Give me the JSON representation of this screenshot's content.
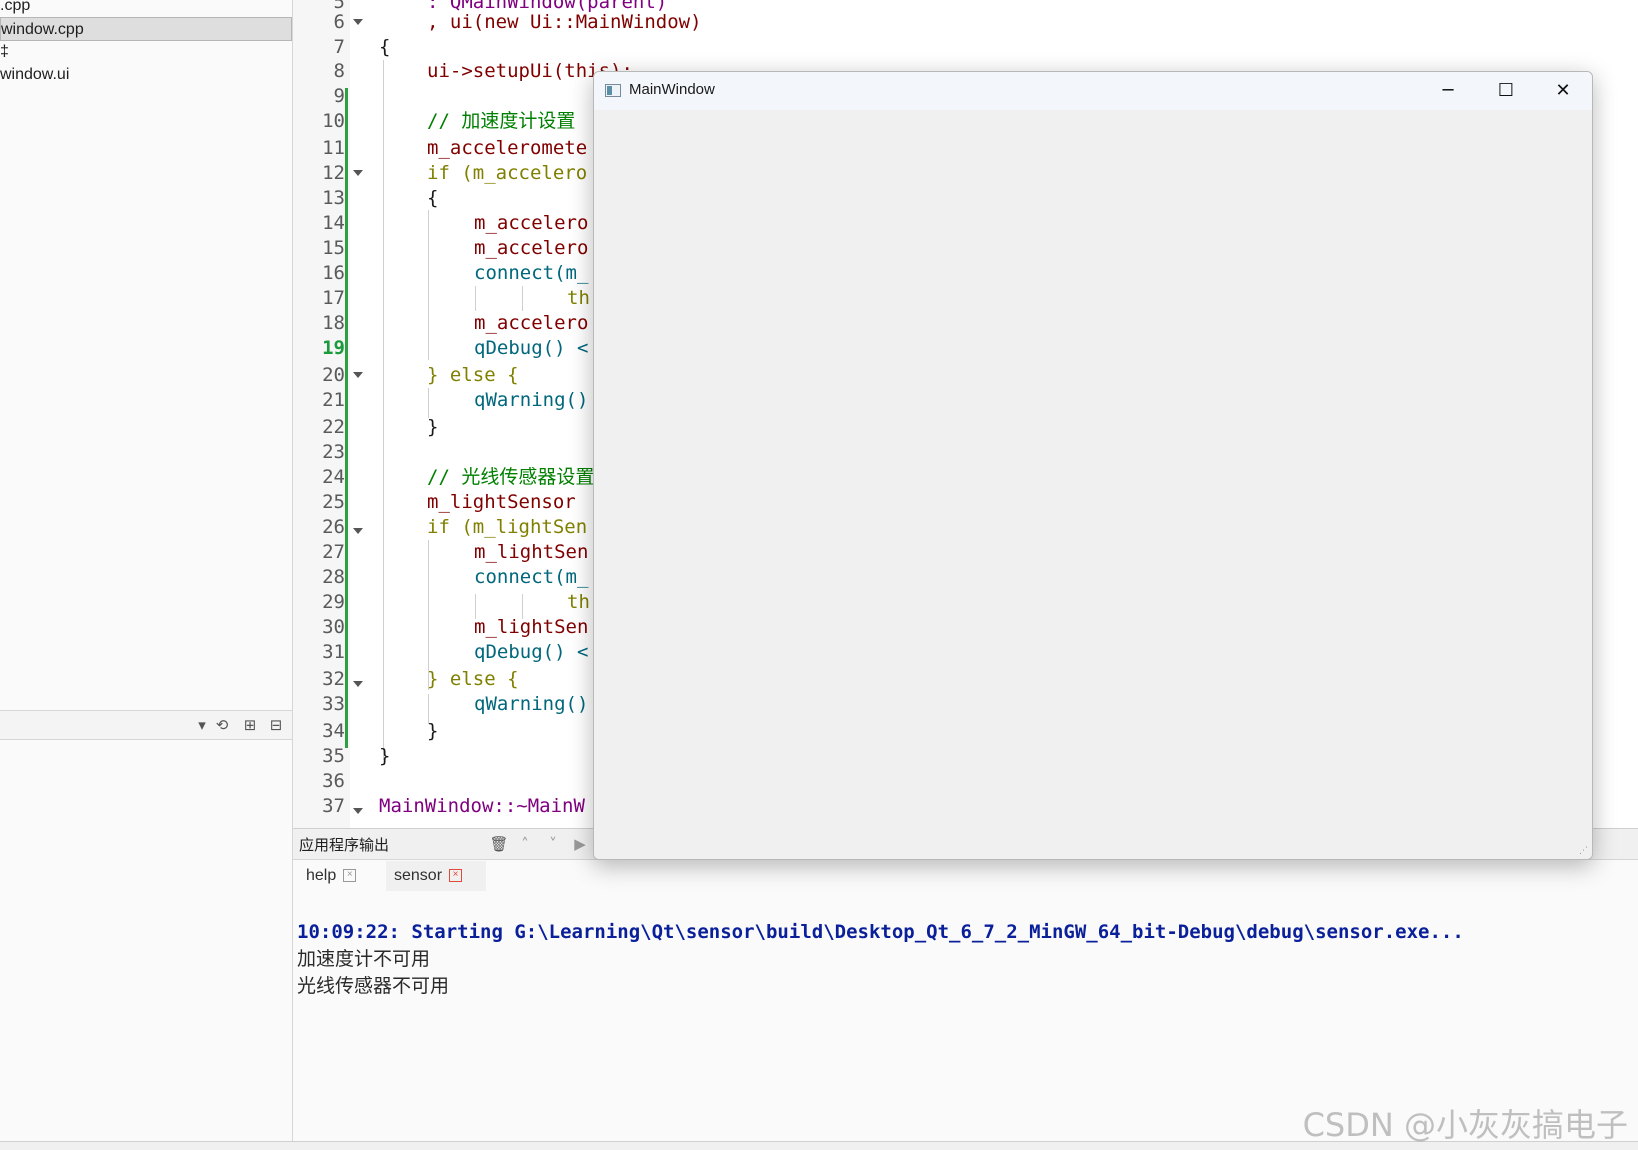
{
  "project_panel": {
    "files": [
      {
        "label": ".cpp",
        "selected": false
      },
      {
        "label": "window.cpp",
        "selected": true
      },
      {
        "label": "‡",
        "selected": false
      },
      {
        "label": "window.ui",
        "selected": false
      }
    ],
    "toolbar": {
      "dropdown_icon": "chevron-down-icon",
      "sync_icon": "sync-icon",
      "expand_icon": "expand-all-icon",
      "collapse_icon": "collapse-all-icon"
    }
  },
  "editor": {
    "current_line": "19",
    "lines": [
      {
        "n": "5",
        "text": ": QMainWindow(parent)"
      },
      {
        "n": "6",
        "text": ", ui(new Ui::MainWindow)"
      },
      {
        "n": "7",
        "text": "{"
      },
      {
        "n": "8",
        "text": "ui->setupUi(this);"
      },
      {
        "n": "9",
        "text": ""
      },
      {
        "n": "10",
        "text": "// 加速度计设置"
      },
      {
        "n": "11",
        "text": "m_acceleromete"
      },
      {
        "n": "12",
        "text": "if (m_accelero"
      },
      {
        "n": "13",
        "text": "{"
      },
      {
        "n": "14",
        "text": "m_accelero"
      },
      {
        "n": "15",
        "text": "m_accelero"
      },
      {
        "n": "16",
        "text": "connect(m_"
      },
      {
        "n": "17",
        "text": "th"
      },
      {
        "n": "18",
        "text": "m_accelero"
      },
      {
        "n": "19",
        "text": "qDebug() <"
      },
      {
        "n": "20",
        "text": "} else {"
      },
      {
        "n": "21",
        "text": "qWarning()"
      },
      {
        "n": "22",
        "text": "}"
      },
      {
        "n": "23",
        "text": ""
      },
      {
        "n": "24",
        "text": "// 光线传感器设置"
      },
      {
        "n": "25",
        "text": "m_lightSensor"
      },
      {
        "n": "26",
        "text": "if (m_lightSen"
      },
      {
        "n": "27",
        "text": "m_lightSen"
      },
      {
        "n": "28",
        "text": "connect(m_"
      },
      {
        "n": "29",
        "text": "th"
      },
      {
        "n": "30",
        "text": "m_lightSen"
      },
      {
        "n": "31",
        "text": "qDebug() <"
      },
      {
        "n": "32",
        "text": "} else {"
      },
      {
        "n": "33",
        "text": "qWarning()"
      },
      {
        "n": "34",
        "text": "}"
      },
      {
        "n": "35",
        "text": "}"
      },
      {
        "n": "36",
        "text": ""
      },
      {
        "n": "37",
        "text": "MainWindow::~MainW"
      }
    ]
  },
  "output": {
    "title": "应用程序输出",
    "tabs": [
      {
        "label": "help",
        "active": false
      },
      {
        "label": "sensor",
        "active": true
      }
    ],
    "start_line": "10:09:22: Starting G:\\Learning\\Qt\\sensor\\build\\Desktop_Qt_6_7_2_MinGW_64_bit-Debug\\debug\\sensor.exe...",
    "messages": [
      "加速度计不可用",
      "光线传感器不可用"
    ],
    "toolbar_icons": [
      "clear-icon",
      "arrow-up-icon",
      "arrow-down-icon",
      "play-icon"
    ]
  },
  "main_window": {
    "title": "MainWindow",
    "minimize_glyph": "─",
    "maximize_glyph": "☐",
    "close_glyph": "✕"
  },
  "watermark": "CSDN @小灰灰搞电子",
  "colors": {
    "keyword": "#808000",
    "function": "#00677c",
    "class": "#800080",
    "member": "#800000",
    "comment": "#008000",
    "output_start": "#0a1f9a",
    "change_bar": "#2ea043"
  }
}
